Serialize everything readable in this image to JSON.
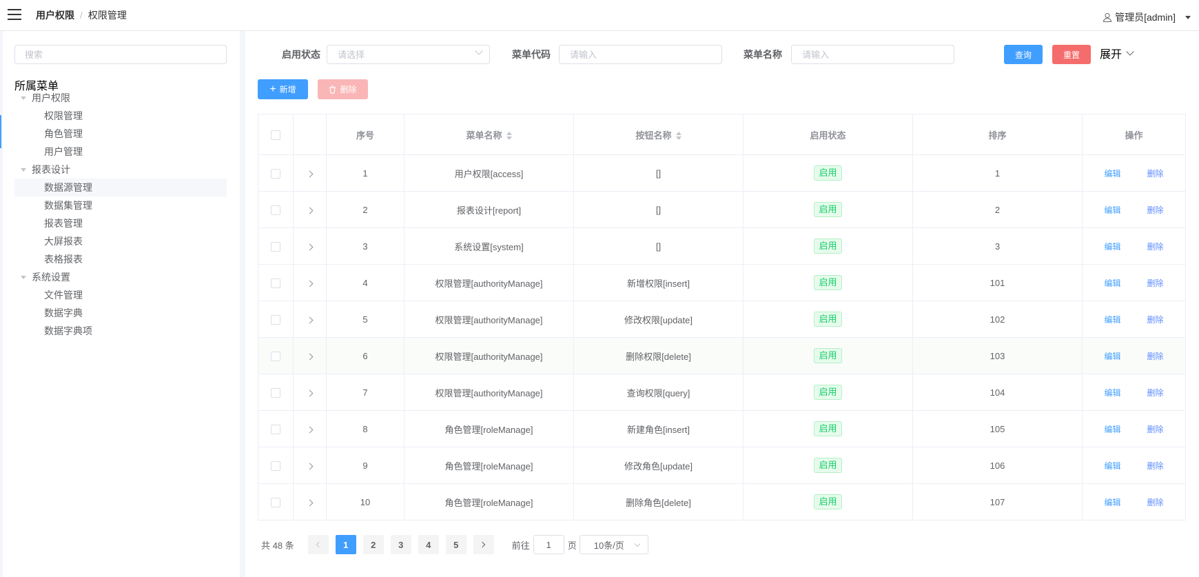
{
  "header": {
    "breadcrumb": [
      "用户权限",
      "权限管理"
    ],
    "breadcrumb_sep": "/",
    "user": "管理员[admin]"
  },
  "sidebar": {
    "search_placeholder": "搜索",
    "tree_title": "所属菜单",
    "groups": [
      {
        "label": "用户权限",
        "children": [
          "权限管理",
          "角色管理",
          "用户管理"
        ]
      },
      {
        "label": "报表设计",
        "children": [
          "数据源管理",
          "数据集管理",
          "报表管理",
          "大屏报表",
          "表格报表"
        ]
      },
      {
        "label": "系统设置",
        "children": [
          "文件管理",
          "数据字典",
          "数据字典项"
        ]
      }
    ],
    "selected": "数据源管理"
  },
  "filters": {
    "status_label": "启用状态",
    "status_placeholder": "请选择",
    "code_label": "菜单代码",
    "code_placeholder": "请输入",
    "name_label": "菜单名称",
    "name_placeholder": "请输入",
    "query": "查询",
    "reset": "重置",
    "expand": "展开"
  },
  "toolbar": {
    "add": "新增",
    "delete": "删除"
  },
  "table": {
    "columns": [
      "序号",
      "菜单名称",
      "按钮名称",
      "启用状态",
      "排序",
      "操作"
    ],
    "edit_label": "编辑",
    "delete_label": "删除",
    "rows": [
      {
        "no": "1",
        "menu": "用户权限[access]",
        "button": "[]",
        "status": "启用",
        "sort": "1"
      },
      {
        "no": "2",
        "menu": "报表设计[report]",
        "button": "[]",
        "status": "启用",
        "sort": "2"
      },
      {
        "no": "3",
        "menu": "系统设置[system]",
        "button": "[]",
        "status": "启用",
        "sort": "3"
      },
      {
        "no": "4",
        "menu": "权限管理[authorityManage]",
        "button": "新增权限[insert]",
        "status": "启用",
        "sort": "101"
      },
      {
        "no": "5",
        "menu": "权限管理[authorityManage]",
        "button": "修改权限[update]",
        "status": "启用",
        "sort": "102"
      },
      {
        "no": "6",
        "menu": "权限管理[authorityManage]",
        "button": "删除权限[delete]",
        "status": "启用",
        "sort": "103"
      },
      {
        "no": "7",
        "menu": "权限管理[authorityManage]",
        "button": "查询权限[query]",
        "status": "启用",
        "sort": "104"
      },
      {
        "no": "8",
        "menu": "角色管理[roleManage]",
        "button": "新建角色[insert]",
        "status": "启用",
        "sort": "105"
      },
      {
        "no": "9",
        "menu": "角色管理[roleManage]",
        "button": "修改角色[update]",
        "status": "启用",
        "sort": "106"
      },
      {
        "no": "10",
        "menu": "角色管理[roleManage]",
        "button": "删除角色[delete]",
        "status": "启用",
        "sort": "107"
      }
    ]
  },
  "pagination": {
    "total": "共 48 条",
    "pages": [
      "1",
      "2",
      "3",
      "4",
      "5"
    ],
    "current": "1",
    "goto_label": "前往",
    "goto_value": "1",
    "page_unit": "页",
    "page_size": "10条/页"
  },
  "colors": {
    "primary": "#409eff",
    "danger": "#f56c6c",
    "success": "#13ce66"
  }
}
